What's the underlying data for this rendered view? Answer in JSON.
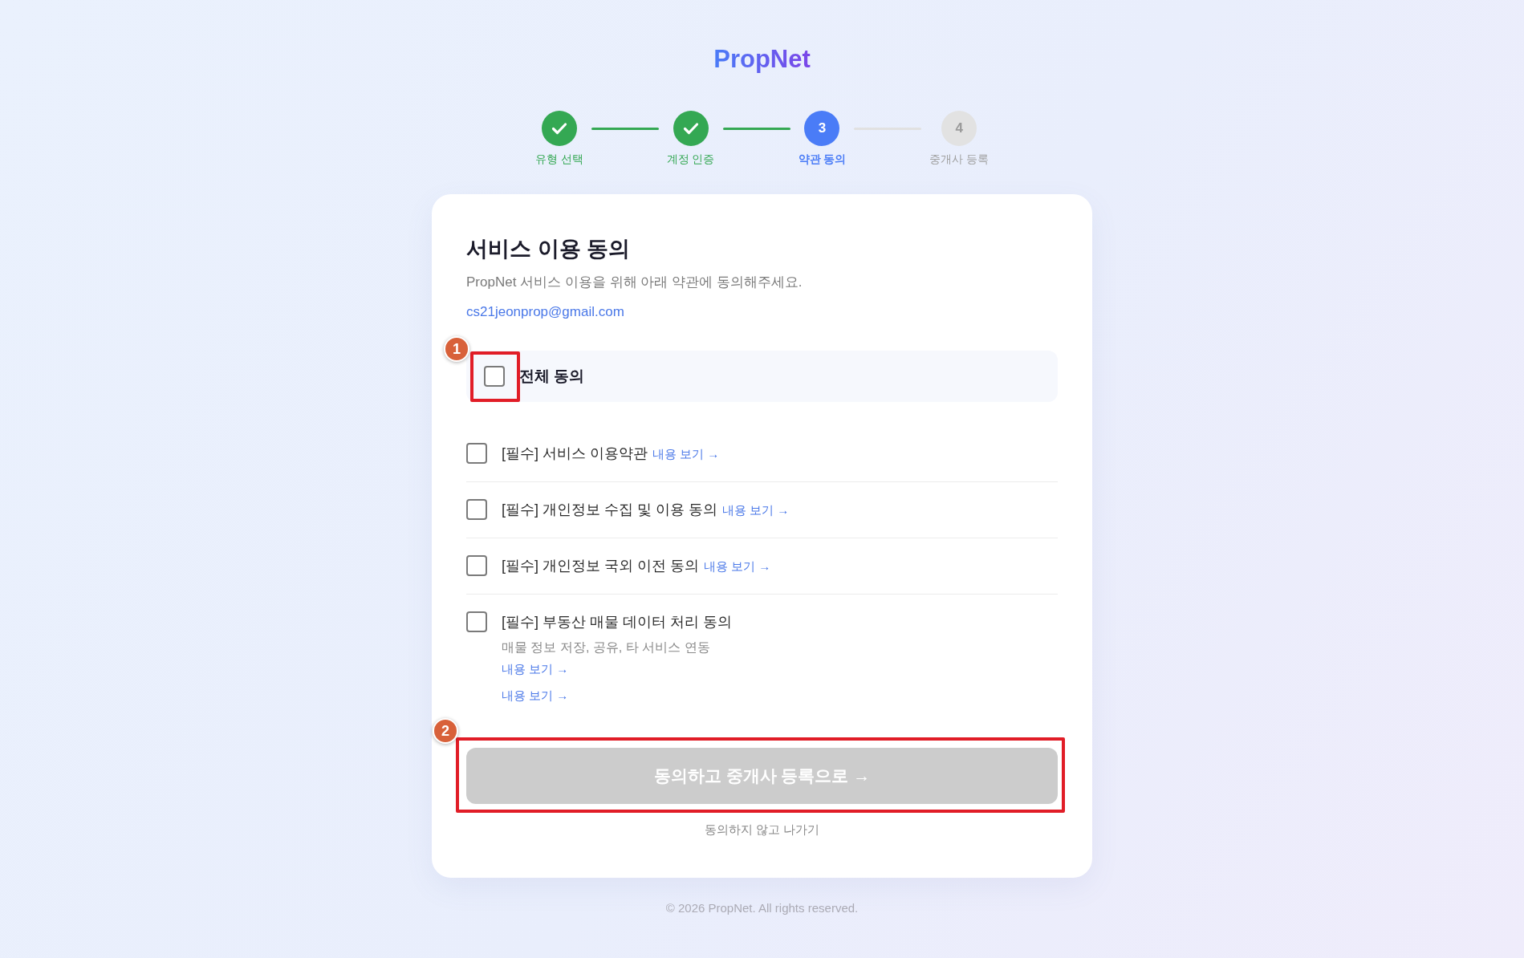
{
  "logo": {
    "text": "PropNet"
  },
  "steps": [
    {
      "label": "유형 선택",
      "completed": true,
      "current": false
    },
    {
      "label": "계정 인증",
      "completed": true,
      "current": false
    },
    {
      "label": "약관 동의",
      "completed": false,
      "current": true,
      "number": "3"
    },
    {
      "label": "중개사 등록",
      "completed": false,
      "current": false,
      "number": "4"
    }
  ],
  "card": {
    "title": "서비스 이용 동의",
    "subtitle": "PropNet 서비스 이용을 위해 아래 약관에 동의해주세요.",
    "email": "cs21jeonprop@gmail.com",
    "agree_all": {
      "label": "전체 동의",
      "checked": false,
      "annotation": "1"
    },
    "terms": [
      {
        "label": "[필수] 서비스 이용약관",
        "checked": false,
        "links": [
          "내용 보기 →"
        ]
      },
      {
        "label": "[필수] 개인정보 수집 및 이용 동의",
        "checked": false,
        "links": [
          "내용 보기 →"
        ]
      },
      {
        "label": "[필수] 개인정보 국외 이전 동의",
        "checked": false,
        "links": [
          "내용 보기 →"
        ]
      },
      {
        "label": "[필수] 부동산 매물 데이터 처리 동의",
        "checked": false,
        "description": "매물 정보 저장, 공유, 타 서비스 연동",
        "links": [
          "내용 보기 →",
          "내용 보기 →"
        ]
      }
    ],
    "submit_button": {
      "label": "동의하고 중개사 등록으로 →",
      "disabled": true,
      "annotation": "2"
    },
    "exit_link": "동의하지 않고 나가기"
  },
  "footer": "© 2026 PropNet. All rights reserved."
}
